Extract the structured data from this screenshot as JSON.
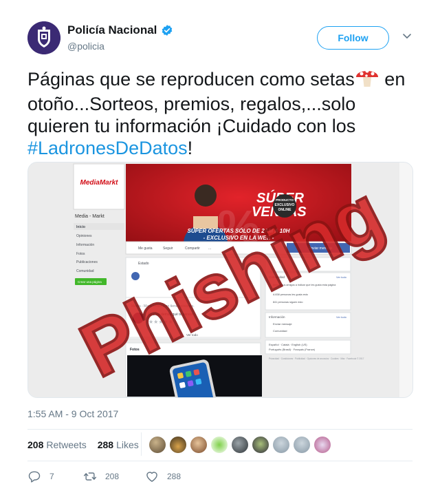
{
  "header": {
    "display_name": "Policía Nacional",
    "handle": "@policia",
    "verified_icon": "verified-badge-icon",
    "follow_label": "Follow",
    "caret_icon": "chevron-down-icon"
  },
  "tweet": {
    "text_part1": "Páginas que se reproducen como setas",
    "text_part2": " en otoño...Sorteos, premios, regalos,...solo quieren tu información ¡Cuidado con los ",
    "hashtag": "#LadronesDeDatos",
    "text_end": "!",
    "emoji_icon": "mushroom-icon"
  },
  "media": {
    "brand": "MediaMarkt",
    "page_name": "Media - Markt",
    "nav": [
      "Inicio",
      "Opiniones",
      "Información",
      "Fotos",
      "Publicaciones",
      "Comunidad"
    ],
    "create_page_button": "Crear una página",
    "banner_title_1": "SÚPER",
    "banner_title_2": "VENTAS",
    "banner_badge_1": "PRODUCTO",
    "banner_badge_2": "EXCLUSIVO",
    "banner_badge_3": "ONLINE",
    "banner_sub_1": "SÚPER OFERTAS SÓLO DE 2AM A 10H",
    "banner_sub_2": "- EXCLUSIVO EN LA WEB -",
    "actions": [
      "Me gusta",
      "Seguir",
      "Compartir",
      "..."
    ],
    "message_button": "Enviar mensaje",
    "status_label": "Estado",
    "community_label": "Comunidad",
    "see_all": "Ver todo",
    "community_items": [
      "Invita a tus amigos a indicar que les gusta esta página",
      "A 838 personas les gusta esto",
      "841 personas siguen esto"
    ],
    "info_label": "Información",
    "info_items": [
      "Enviar mensaje",
      "Comunidad"
    ],
    "opinions_text": "Media - Markt todavía no tiene opiniones.",
    "opinion_prompt": "Di a los demás qué te parece",
    "photos_label": "Fotos",
    "languages_1": "Español · Català · English (US)",
    "languages_2": "Português (Brasil) · Français (France)",
    "footer_links": "Privacidad · Condiciones · Publicidad · Opciones de anuncios · Cookies · Más · Facebook © 2017",
    "overlay_stamp": "Phishing",
    "stamp_color": "#d42a2a"
  },
  "meta": {
    "timestamp": "1:55 AM - 9 Oct 2017"
  },
  "stats": {
    "retweets_count": "208",
    "retweets_label": "Retweets",
    "likes_count": "288",
    "likes_label": "Likes",
    "liker_avatars": [
      "avatar-1",
      "avatar-2",
      "avatar-3",
      "avatar-4",
      "avatar-5",
      "avatar-6",
      "avatar-7",
      "avatar-8",
      "avatar-9"
    ]
  },
  "actions": {
    "reply_icon": "reply-icon",
    "reply_count": "7",
    "retweet_icon": "retweet-icon",
    "retweet_count": "208",
    "like_icon": "heart-icon",
    "like_count": "288"
  },
  "colors": {
    "accent": "#1da1f2",
    "hashtag": "#1b95e0",
    "muted": "#657786",
    "mediamarkt_red": "#d10c15"
  }
}
